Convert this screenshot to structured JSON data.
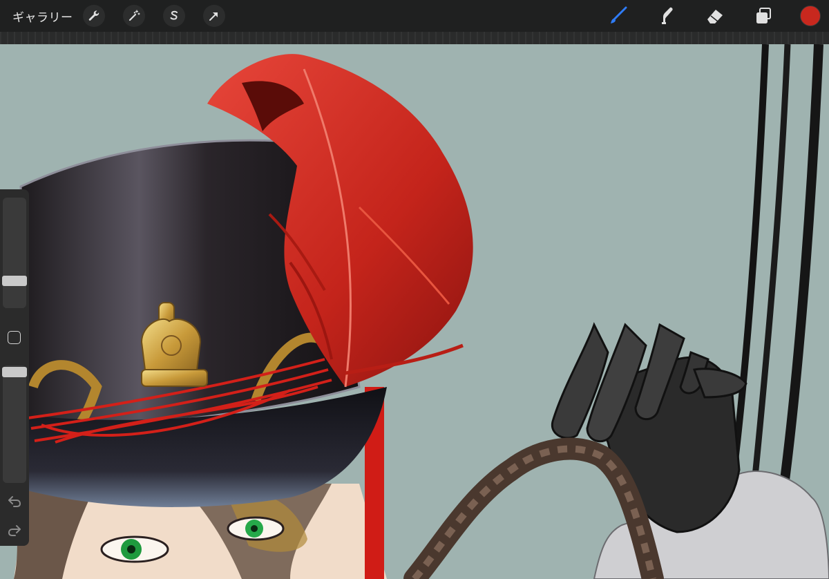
{
  "toolbar": {
    "gallery_label": "ギャラリー",
    "left_tools": [
      "wrench-icon",
      "magic-wand-icon",
      "selection-s-icon",
      "move-arrow-icon"
    ],
    "right_tools": [
      "brush-icon",
      "smudge-icon",
      "eraser-icon",
      "layers-icon"
    ],
    "active_tool": "brush-icon",
    "current_color": "#c8281e",
    "active_tool_color": "#2f7cf6"
  },
  "sidebar": {
    "brush_size_level": 0.6,
    "opacity_level": 0.95
  },
  "canvas": {
    "background_color": "#9fb3b0"
  }
}
